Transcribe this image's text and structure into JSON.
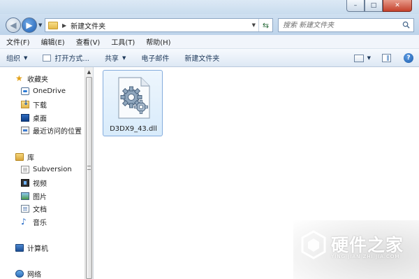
{
  "window": {
    "minimize_glyph": "–",
    "maximize_glyph": "□",
    "close_glyph": "✕"
  },
  "address": {
    "crumb_arrow": "▶",
    "path": "新建文件夹",
    "search_placeholder": "搜索 新建文件夹"
  },
  "menu": [
    "文件(F)",
    "编辑(E)",
    "查看(V)",
    "工具(T)",
    "帮助(H)"
  ],
  "commands": {
    "organize": "组织",
    "open_with": "打开方式...",
    "share": "共享",
    "email": "电子邮件",
    "new_folder": "新建文件夹",
    "help_glyph": "?"
  },
  "nav": {
    "favorites": "收藏夹",
    "onedrive": "OneDrive",
    "downloads": "下载",
    "desktop": "桌面",
    "recent": "最近访问的位置",
    "libraries": "库",
    "subversion": "Subversion",
    "videos": "视频",
    "pictures": "图片",
    "documents": "文档",
    "music": "音乐",
    "computer": "计算机",
    "network": "网络"
  },
  "files": [
    {
      "name": "D3DX9_43.dll",
      "icon": "dll-gear-icon",
      "selected": true
    }
  ],
  "watermark": {
    "title": "硬件之家",
    "subtitle": "YING JIAN ZHI JIA.COM"
  },
  "colors": {
    "selection": "#d8ebfb",
    "accent": "#1d5fb4"
  }
}
